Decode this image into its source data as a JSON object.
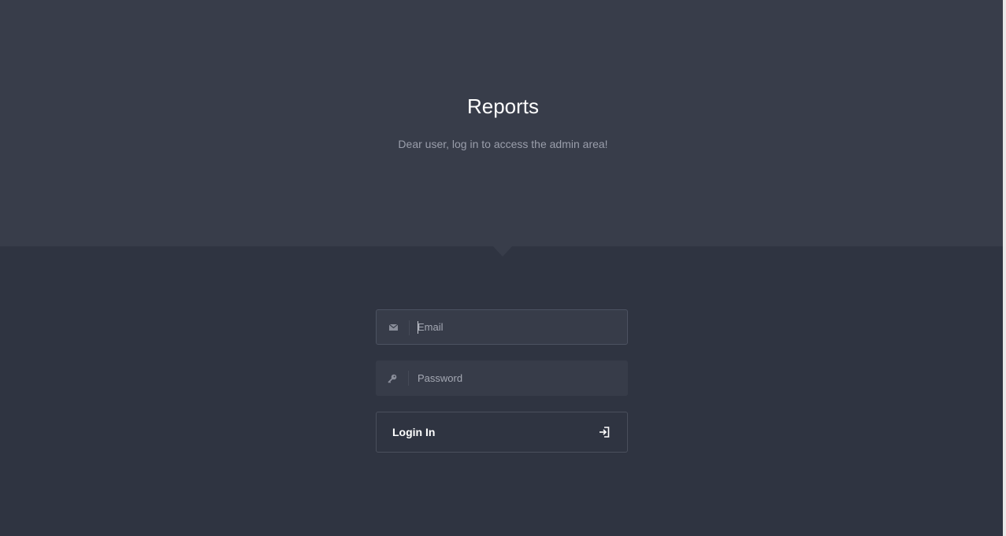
{
  "header": {
    "title": "Reports",
    "subtitle": "Dear user, log in to access the admin area!"
  },
  "form": {
    "email": {
      "placeholder": "Email",
      "value": "",
      "icon": "envelope-icon"
    },
    "password": {
      "placeholder": "Password",
      "value": "",
      "icon": "key-icon"
    },
    "login": {
      "label": "Login In",
      "icon": "sign-in-icon"
    }
  },
  "colors": {
    "header_bg": "#383d4a",
    "page_bg": "#2f3441",
    "field_bg": "#373c49",
    "title": "#ffffff",
    "subtitle": "#9a9eab"
  }
}
